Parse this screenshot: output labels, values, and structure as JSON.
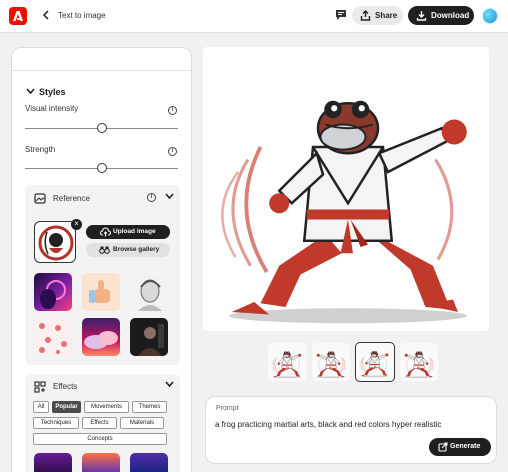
{
  "header": {
    "back_icon": "chevron-left-icon",
    "title": "Text to image",
    "share_label": "Share",
    "download_label": "Download",
    "brand_color": "#eb1000"
  },
  "styles": {
    "heading": "Styles",
    "sliders": [
      {
        "label": "Visual intensity",
        "value_fraction": 0.5
      },
      {
        "label": "Strength",
        "value_fraction": 0.5
      }
    ]
  },
  "reference": {
    "heading": "Reference",
    "upload_label": "Upload image",
    "browse_label": "Browse gallery"
  },
  "effects": {
    "heading": "Effects",
    "chips": [
      "All",
      "Popular",
      "Movements",
      "Themes",
      "Techniques",
      "Effects",
      "Materials",
      "Concepts"
    ],
    "active_chip": "Popular"
  },
  "prompt": {
    "label": "Prompt",
    "text": "a frog practicing martial arts, black and red colors hyper realistic",
    "generate_label": "Generate"
  },
  "variations": {
    "count": 4,
    "selected_index": 2
  }
}
